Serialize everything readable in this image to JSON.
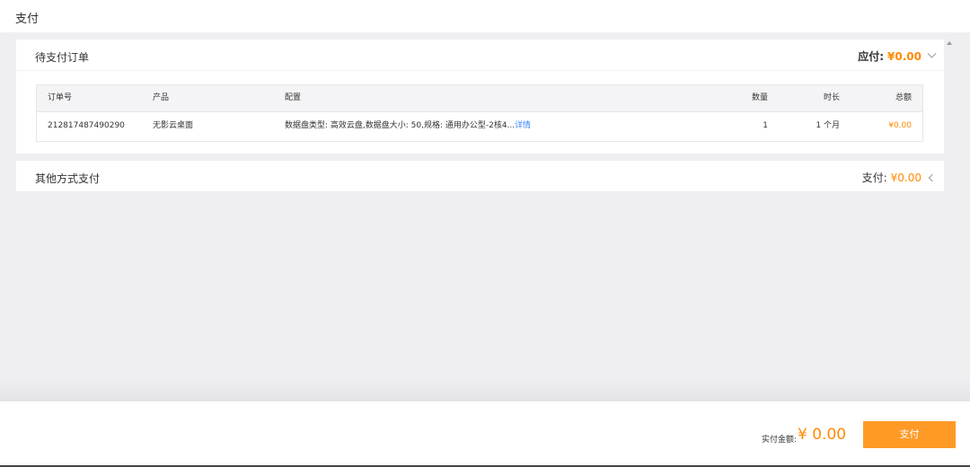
{
  "header": {
    "title": "支付"
  },
  "pending_orders": {
    "title": "待支付订单",
    "payable_label": "应付:",
    "payable_amount": "¥0.00",
    "table": {
      "columns": [
        "订单号",
        "产品",
        "配置",
        "数量",
        "时长",
        "总额"
      ],
      "rows": [
        {
          "order_id": "212817487490290",
          "product": "无影云桌面",
          "config": "数据盘类型: 高效云盘,数据盘大小: 50,规格: 通用办公型-2核4...",
          "detail_link": "详情",
          "quantity": "1",
          "duration": "1 个月",
          "total": "¥0.00"
        }
      ]
    }
  },
  "other_payment": {
    "title": "其他方式支付",
    "pay_label": "支付:",
    "pay_amount": "¥0.00"
  },
  "footer": {
    "actual_label": "实付金额:",
    "actual_amount": "¥ 0.00",
    "pay_button_label": "支付"
  },
  "colors": {
    "accent": "#ff8a00",
    "button": "#ff9a27",
    "link": "#3a86ff",
    "background": "#efeff2"
  },
  "icons": {
    "collapse": "chevron-down-icon",
    "expand": "chevron-left-icon",
    "scroll": "scroll-up-icon"
  }
}
